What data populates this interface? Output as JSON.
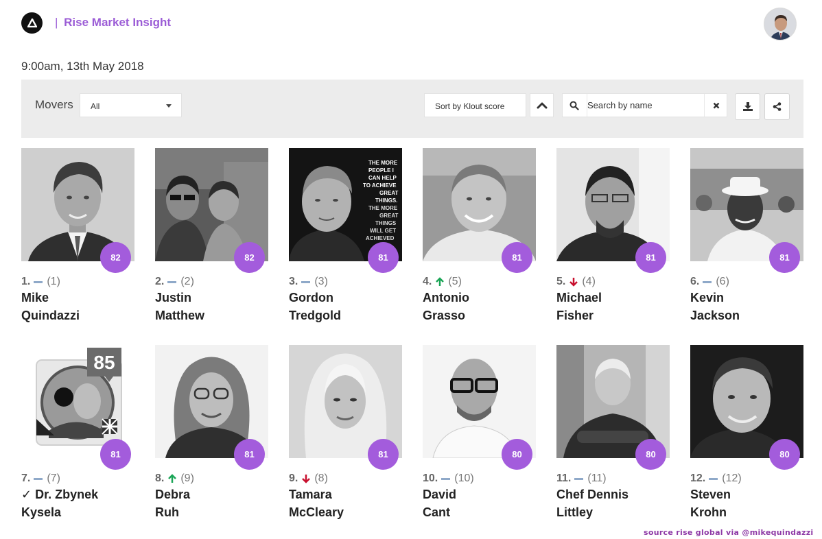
{
  "header": {
    "brand_separator": "|",
    "brand": "Rise Market Insight",
    "logo_icon": "triangle-logo-icon",
    "avatar_icon": "user-avatar"
  },
  "timestamp": "9:00am, 13th May 2018",
  "toolbar": {
    "movers_label": "Movers",
    "filter_value": "All",
    "sort_label": "Sort by Klout score",
    "sort_direction_icon": "chevron-up-icon",
    "search_placeholder": "Search by name",
    "clear_icon": "close-icon",
    "download_icon": "download-icon",
    "share_icon": "share-icon"
  },
  "colors": {
    "accent": "#a35cdc",
    "brand": "#9b5cd6",
    "up": "#1aa556",
    "down": "#c8102e",
    "same": "#8fa9c9",
    "footer": "#8e3aa6"
  },
  "people": [
    {
      "rank": "1.",
      "trend": "same",
      "prev": "(1)",
      "first": "Mike",
      "last": "Quindazzi",
      "score": "82"
    },
    {
      "rank": "2.",
      "trend": "same",
      "prev": "(2)",
      "first": "Justin",
      "last": "Matthew",
      "score": "82"
    },
    {
      "rank": "3.",
      "trend": "same",
      "prev": "(3)",
      "first": "Gordon",
      "last": "Tredgold",
      "score": "81"
    },
    {
      "rank": "4.",
      "trend": "up",
      "prev": "(5)",
      "first": "Antonio",
      "last": "Grasso",
      "score": "81"
    },
    {
      "rank": "5.",
      "trend": "down",
      "prev": "(4)",
      "first": "Michael",
      "last": "Fisher",
      "score": "81"
    },
    {
      "rank": "6.",
      "trend": "same",
      "prev": "(6)",
      "first": "Kevin",
      "last": "Jackson",
      "score": "81"
    },
    {
      "rank": "7.",
      "trend": "same",
      "prev": "(7)",
      "first": "✓ Dr. Zbynek",
      "last": "Kysela",
      "score": "81"
    },
    {
      "rank": "8.",
      "trend": "up",
      "prev": "(9)",
      "first": "Debra",
      "last": "Ruh",
      "score": "81"
    },
    {
      "rank": "9.",
      "trend": "down",
      "prev": "(8)",
      "first": "Tamara",
      "last": "McCleary",
      "score": "81"
    },
    {
      "rank": "10.",
      "trend": "same",
      "prev": "(10)",
      "first": "David",
      "last": "Cant",
      "score": "80"
    },
    {
      "rank": "11.",
      "trend": "same",
      "prev": "(11)",
      "first": "Chef Dennis",
      "last": "Littley",
      "score": "80"
    },
    {
      "rank": "12.",
      "trend": "same",
      "prev": "(12)",
      "first": "Steven",
      "last": "Krohn",
      "score": "80"
    }
  ],
  "photo_overlays": {
    "gordon_text": "THE MORE PEOPLE I CAN HELP TO ACHIEVE GREAT THINGS, THE MORE GREAT THINGS WILL GET ACHIEVED",
    "zbynek_badge": "85"
  },
  "footer": "source rise global via @mikequindazzi"
}
